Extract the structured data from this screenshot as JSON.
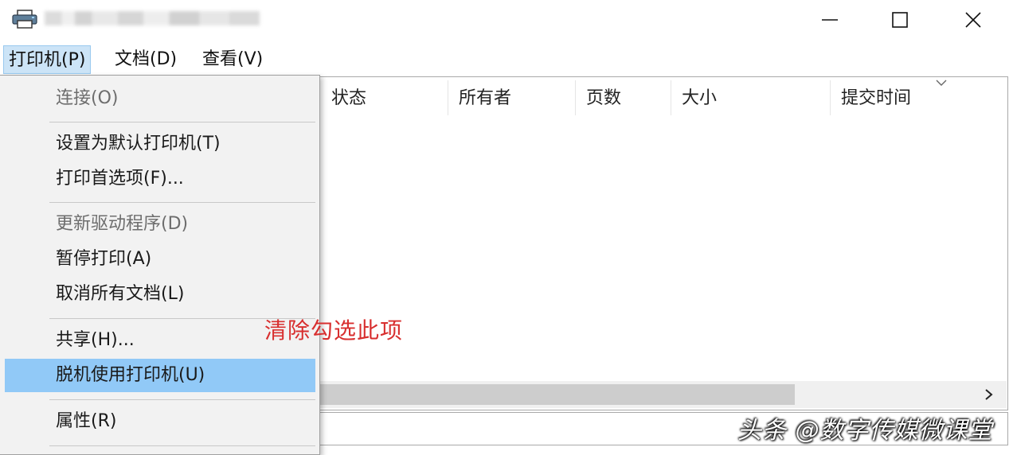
{
  "window": {
    "controls": [
      "minimize",
      "maximize",
      "close"
    ]
  },
  "menubar": {
    "items": [
      {
        "label": "打印机(P)"
      },
      {
        "label": "文档(D)"
      },
      {
        "label": "查看(V)"
      }
    ]
  },
  "list": {
    "columns": [
      "状态",
      "所有者",
      "页数",
      "大小",
      "提交时间"
    ]
  },
  "dropdown": {
    "items": [
      {
        "label": "连接(O)",
        "state": "disabled"
      },
      {
        "label": "设置为默认打印机(T)",
        "state": "normal"
      },
      {
        "label": "打印首选项(F)...",
        "state": "normal"
      },
      {
        "label": "更新驱动程序(D)",
        "state": "disabled"
      },
      {
        "label": "暂停打印(A)",
        "state": "normal"
      },
      {
        "label": "取消所有文档(L)",
        "state": "normal"
      },
      {
        "label": "共享(H)...",
        "state": "normal"
      },
      {
        "label": "脱机使用打印机(U)",
        "state": "highlighted"
      },
      {
        "label": "属性(R)",
        "state": "normal"
      }
    ]
  },
  "annotation": {
    "text": "清除勾选此项",
    "color": "#d82f2f"
  },
  "watermark": {
    "text": "头条 @数字传媒微课堂"
  },
  "colors": {
    "menu_active_bg": "#cce4f7",
    "highlight_bg": "#91c9f7",
    "dropdown_bg": "#f2f2f2"
  },
  "icons": {
    "app": "printer-icon",
    "sort": "chevron-down-icon",
    "scroll_right": "chevron-right-icon"
  }
}
